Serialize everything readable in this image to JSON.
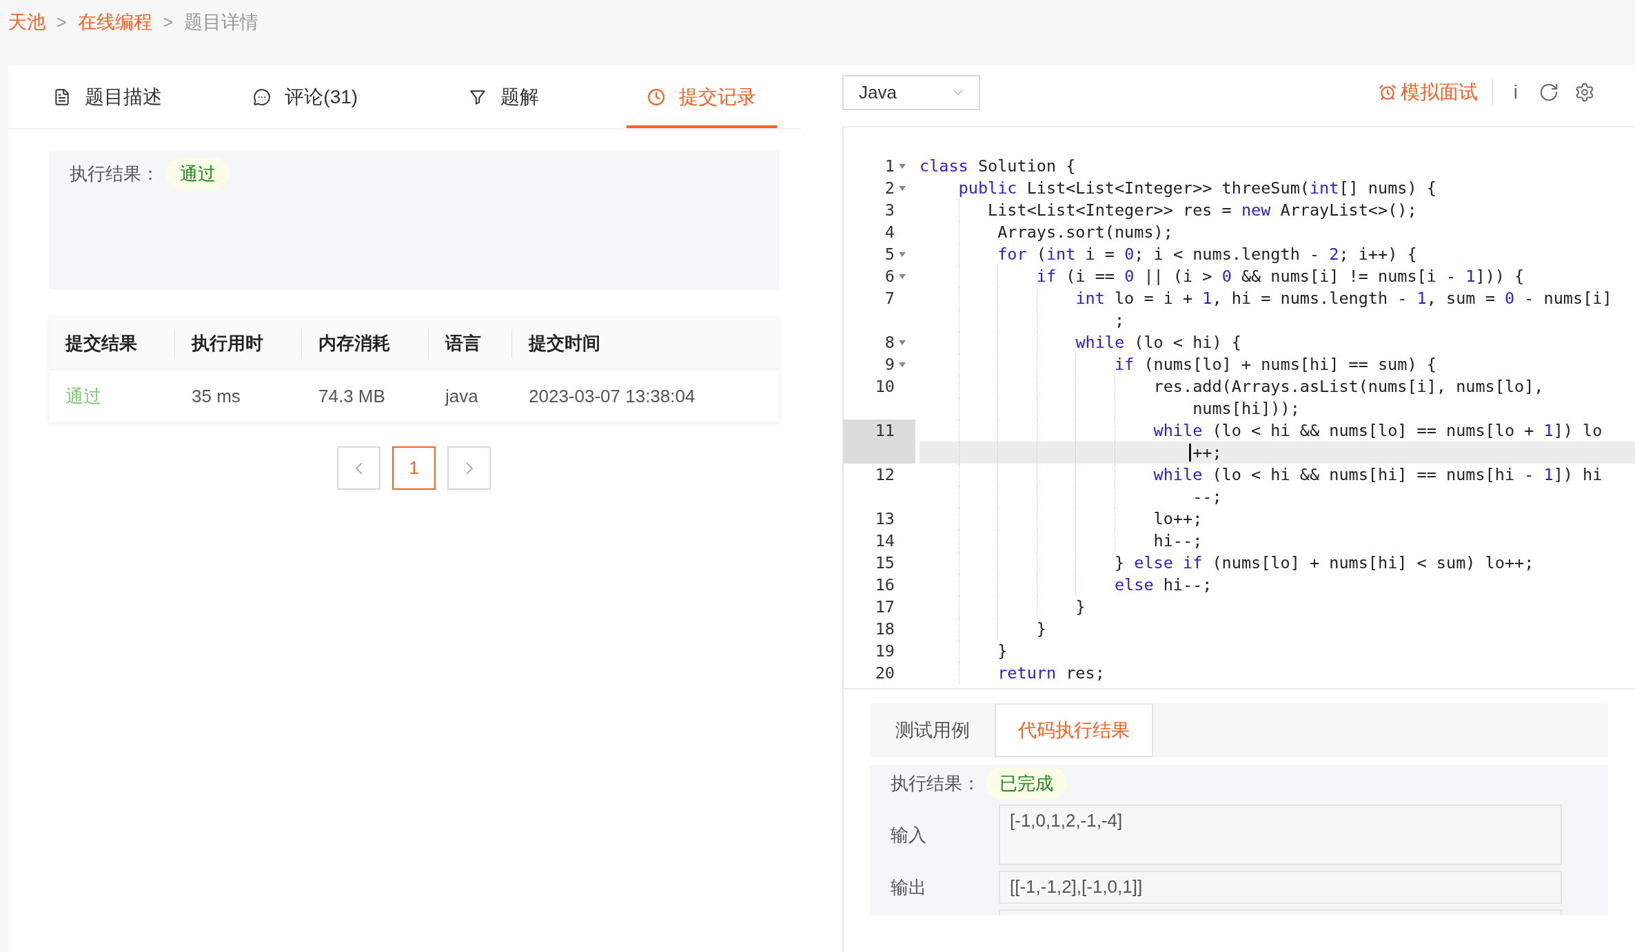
{
  "breadcrumb": [
    {
      "label": "天池",
      "current": false
    },
    {
      "label": "在线编程",
      "current": false
    },
    {
      "label": "题目详情",
      "current": true
    }
  ],
  "breadcrumb_separators": [
    ">",
    ">"
  ],
  "tabs": [
    {
      "label": "题目描述",
      "selected": false
    },
    {
      "label": "评论(31)",
      "selected": false
    },
    {
      "label": "题解",
      "selected": false
    },
    {
      "label": "提交记录",
      "selected": true
    }
  ],
  "result": {
    "label": "执行结果：",
    "status": "通过"
  },
  "table": {
    "columns": [
      "提交结果",
      "执行用时",
      "内存消耗",
      "语言",
      "提交时间"
    ],
    "rows": [
      {
        "cells": [
          "通过",
          "35 ms",
          "74.3 MB",
          "java",
          "2023-03-07 13:38:04"
        ]
      }
    ]
  },
  "pagination": {
    "pages": [
      {
        "label": "1",
        "selected": true
      }
    ]
  },
  "editor": {
    "language": "Java",
    "mock_interview": "模拟面试",
    "info": "i",
    "lines": [
      {
        "number": "1",
        "foldable": true,
        "active": false,
        "segments": [
          {
            "kind": "keyword",
            "text": "class"
          },
          {
            "kind": "plain",
            "text": " Solution {"
          }
        ]
      },
      {
        "number": "2",
        "foldable": true,
        "active": false,
        "segments": [
          {
            "kind": "keyword",
            "text": "    public"
          },
          {
            "kind": "plain",
            "text": " List<List<Integer>> threeSum("
          },
          {
            "kind": "keyword",
            "text": "int"
          },
          {
            "kind": "plain",
            "text": "[] nums) {"
          }
        ]
      },
      {
        "number": "3",
        "foldable": false,
        "active": false,
        "segments": [
          {
            "kind": "plain",
            "text": "       List<List<Integer>> res = "
          },
          {
            "kind": "keyword",
            "text": "new"
          },
          {
            "kind": "plain",
            "text": " ArrayList<>();"
          }
        ]
      },
      {
        "number": "4",
        "foldable": false,
        "active": false,
        "segments": [
          {
            "kind": "plain",
            "text": "        Arrays.sort(nums);"
          }
        ]
      },
      {
        "number": "5",
        "foldable": true,
        "active": false,
        "segments": [
          {
            "kind": "keyword",
            "text": "        for"
          },
          {
            "kind": "plain",
            "text": " ("
          },
          {
            "kind": "keyword",
            "text": "int"
          },
          {
            "kind": "plain",
            "text": " i = "
          },
          {
            "kind": "number",
            "text": "0"
          },
          {
            "kind": "plain",
            "text": "; i < nums.length - "
          },
          {
            "kind": "number",
            "text": "2"
          },
          {
            "kind": "plain",
            "text": "; i++) {"
          }
        ]
      },
      {
        "number": "6",
        "foldable": true,
        "active": false,
        "segments": [
          {
            "kind": "keyword",
            "text": "            if"
          },
          {
            "kind": "plain",
            "text": " (i == "
          },
          {
            "kind": "number",
            "text": "0"
          },
          {
            "kind": "plain",
            "text": " || (i > "
          },
          {
            "kind": "number",
            "text": "0"
          },
          {
            "kind": "plain",
            "text": " && nums[i] != nums[i - "
          },
          {
            "kind": "number",
            "text": "1"
          },
          {
            "kind": "plain",
            "text": "])) {"
          }
        ]
      },
      {
        "number": "7",
        "foldable": false,
        "active": false,
        "segments": [
          {
            "kind": "keyword",
            "text": "                int"
          },
          {
            "kind": "plain",
            "text": " lo = i + "
          },
          {
            "kind": "number",
            "text": "1"
          },
          {
            "kind": "plain",
            "text": ", hi = nums.length - "
          },
          {
            "kind": "number",
            "text": "1"
          },
          {
            "kind": "plain",
            "text": ", sum = "
          },
          {
            "kind": "number",
            "text": "0"
          },
          {
            "kind": "plain",
            "text": " - nums[i]"
          }
        ],
        "wrap": [
          {
            "kind": "plain",
            "text": "                    ;"
          }
        ]
      },
      {
        "number": "8",
        "foldable": true,
        "active": false,
        "segments": [
          {
            "kind": "keyword",
            "text": "                while"
          },
          {
            "kind": "plain",
            "text": " (lo < hi) {"
          }
        ]
      },
      {
        "number": "9",
        "foldable": true,
        "active": false,
        "segments": [
          {
            "kind": "keyword",
            "text": "                    if"
          },
          {
            "kind": "plain",
            "text": " (nums[lo] + nums[hi] == sum) {"
          }
        ]
      },
      {
        "number": "10",
        "foldable": false,
        "active": false,
        "segments": [
          {
            "kind": "plain",
            "text": "                        res.add(Arrays.asList(nums[i], nums[lo],"
          }
        ],
        "wrap": [
          {
            "kind": "plain",
            "text": "                            nums[hi]));"
          }
        ]
      },
      {
        "number": "11",
        "foldable": false,
        "active": true,
        "segments": [
          {
            "kind": "keyword",
            "text": "                        while"
          },
          {
            "kind": "plain",
            "text": " (lo < hi && nums[lo] == nums[lo + "
          },
          {
            "kind": "number",
            "text": "1"
          },
          {
            "kind": "plain",
            "text": "]) lo"
          }
        ],
        "wrap": [
          {
            "kind": "plain",
            "text": "                            ++;"
          }
        ]
      },
      {
        "number": "12",
        "foldable": false,
        "active": false,
        "segments": [
          {
            "kind": "keyword",
            "text": "                        while"
          },
          {
            "kind": "plain",
            "text": " (lo < hi && nums[hi] == nums[hi - "
          },
          {
            "kind": "number",
            "text": "1"
          },
          {
            "kind": "plain",
            "text": "]) hi"
          }
        ],
        "wrap": [
          {
            "kind": "plain",
            "text": "                            --;"
          }
        ]
      },
      {
        "number": "13",
        "foldable": false,
        "active": false,
        "segments": [
          {
            "kind": "plain",
            "text": "                        lo++;"
          }
        ]
      },
      {
        "number": "14",
        "foldable": false,
        "active": false,
        "segments": [
          {
            "kind": "plain",
            "text": "                        hi--;"
          }
        ]
      },
      {
        "number": "15",
        "foldable": false,
        "active": false,
        "segments": [
          {
            "kind": "plain",
            "text": "                    } "
          },
          {
            "kind": "keyword",
            "text": "else if"
          },
          {
            "kind": "plain",
            "text": " (nums[lo] + nums[hi] < sum) lo++;"
          }
        ]
      },
      {
        "number": "16",
        "foldable": false,
        "active": false,
        "segments": [
          {
            "kind": "keyword",
            "text": "                    else"
          },
          {
            "kind": "plain",
            "text": " hi--;"
          }
        ]
      },
      {
        "number": "17",
        "foldable": false,
        "active": false,
        "segments": [
          {
            "kind": "plain",
            "text": "                }"
          }
        ]
      },
      {
        "number": "18",
        "foldable": false,
        "active": false,
        "segments": [
          {
            "kind": "plain",
            "text": "            }"
          }
        ]
      },
      {
        "number": "19",
        "foldable": false,
        "active": false,
        "segments": [
          {
            "kind": "plain",
            "text": "        }"
          }
        ]
      },
      {
        "number": "20",
        "foldable": false,
        "active": false,
        "segments": [
          {
            "kind": "keyword",
            "text": "        return"
          },
          {
            "kind": "plain",
            "text": " res;"
          }
        ]
      }
    ]
  },
  "console": {
    "tabs": [
      {
        "label": "测试用例",
        "selected": false
      },
      {
        "label": "代码执行结果",
        "selected": true
      }
    ],
    "result_label": "执行结果：",
    "status": "已完成",
    "fields": [
      {
        "label": "输入",
        "value": "[-1,0,1,2,-1,-4]"
      },
      {
        "label": "输出",
        "value": "[[-1,-1,2],[-1,0,1]]"
      }
    ]
  }
}
